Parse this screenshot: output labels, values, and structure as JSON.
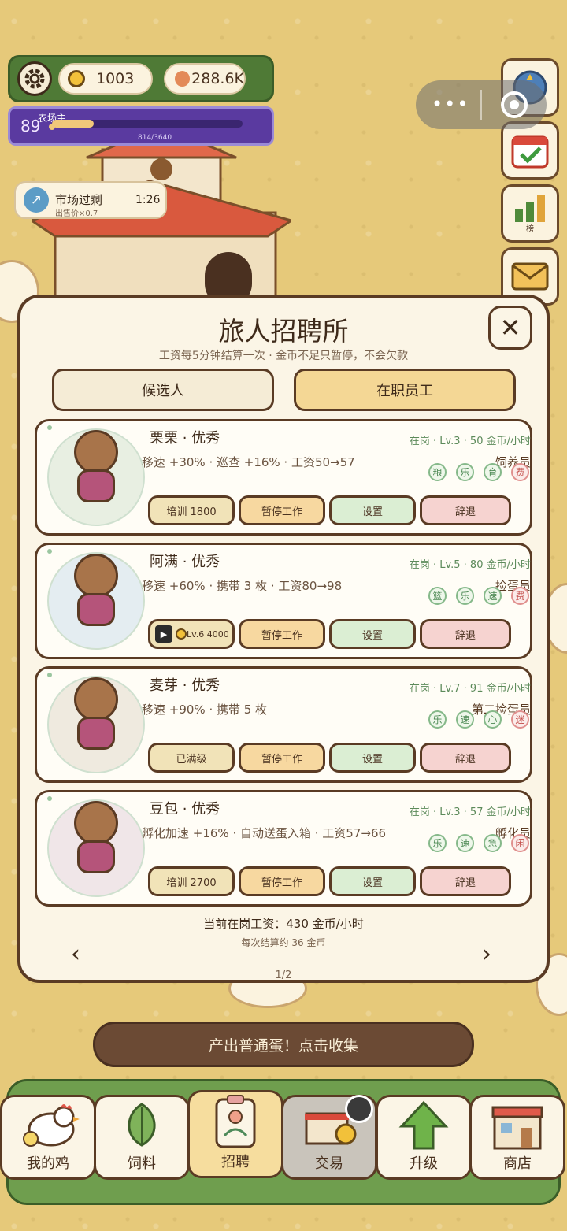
{
  "hud": {
    "coins": "1003",
    "eggs": "288.6K",
    "level": "89",
    "level_title": "农场主",
    "exp_text": "814/3640",
    "exp_progress": 0.22
  },
  "market_event": {
    "title": "市场过剩",
    "subtitle": "出售价×0.7",
    "timer": "1:26"
  },
  "side_buttons": [
    {
      "icon": "globe-icon",
      "label": ""
    },
    {
      "icon": "calendar-check-icon",
      "label": ""
    },
    {
      "icon": "leaderboard-icon",
      "label": "榜"
    },
    {
      "icon": "mail-icon",
      "label": ""
    }
  ],
  "modal": {
    "title": "旅人招聘所",
    "subtitle": "工资每5分钟结算一次 · 金币不足只暂停，不会欠款",
    "tabs": [
      "候选人",
      "在职员工"
    ],
    "active_tab": "在职员工",
    "employees": [
      {
        "name": "栗栗 · 优秀",
        "status": "在岗 · Lv.3 · 50 金币/小时",
        "desc": "移速 +30% · 巡查 +16% · 工资50→57",
        "role": "饲养员",
        "tags": [
          "粮",
          "乐",
          "育",
          "费"
        ],
        "buttons": [
          "培训 1800",
          "暂停工作",
          "设置",
          "辞退"
        ],
        "bg": "#e8efe2"
      },
      {
        "name": "阿满 · 优秀",
        "status": "在岗 · Lv.5 · 80 金币/小时",
        "desc": "移速 +60% · 携带 3 枚 · 工资80→98",
        "role": "捡蛋员",
        "tags": [
          "篮",
          "乐",
          "速",
          "费"
        ],
        "buttons": [
          "Lv.6 4000",
          "暂停工作",
          "设置",
          "辞退"
        ],
        "bg": "#e4edf1"
      },
      {
        "name": "麦芽 · 优秀",
        "status": "在岗 · Lv.7 · 91 金币/小时",
        "desc": "移速 +90% · 携带 5 枚",
        "role": "第二捡蛋员",
        "tags": [
          "乐",
          "速",
          "心",
          "迷"
        ],
        "buttons": [
          "已满级",
          "暂停工作",
          "设置",
          "辞退"
        ],
        "bg": "#efeadf"
      },
      {
        "name": "豆包 · 优秀",
        "status": "在岗 · Lv.3 · 57 金币/小时",
        "desc": "孵化加速 +16% · 自动送蛋入箱 · 工资57→66",
        "role": "孵化员",
        "tags": [
          "乐",
          "速",
          "急",
          "闲"
        ],
        "buttons": [
          "培训 2700",
          "暂停工作",
          "设置",
          "辞退"
        ],
        "bg": "#f0e6e8"
      }
    ],
    "wage_total": "当前在岗工资：430 金币/小时",
    "wage_per_settle": "每次结算约 36 金币",
    "prev": "‹",
    "next": "›",
    "page": "1/2"
  },
  "collect_label": "产出普通蛋！点击收集",
  "nav": [
    {
      "label": "我的鸡",
      "icon": "chicken-icon"
    },
    {
      "label": "饲料",
      "icon": "leaf-icon"
    },
    {
      "label": "招聘",
      "icon": "id-badge-icon"
    },
    {
      "label": "交易",
      "icon": "market-stall-icon"
    },
    {
      "label": "升级",
      "icon": "up-arrow-icon"
    },
    {
      "label": "商店",
      "icon": "shop-icon"
    }
  ]
}
